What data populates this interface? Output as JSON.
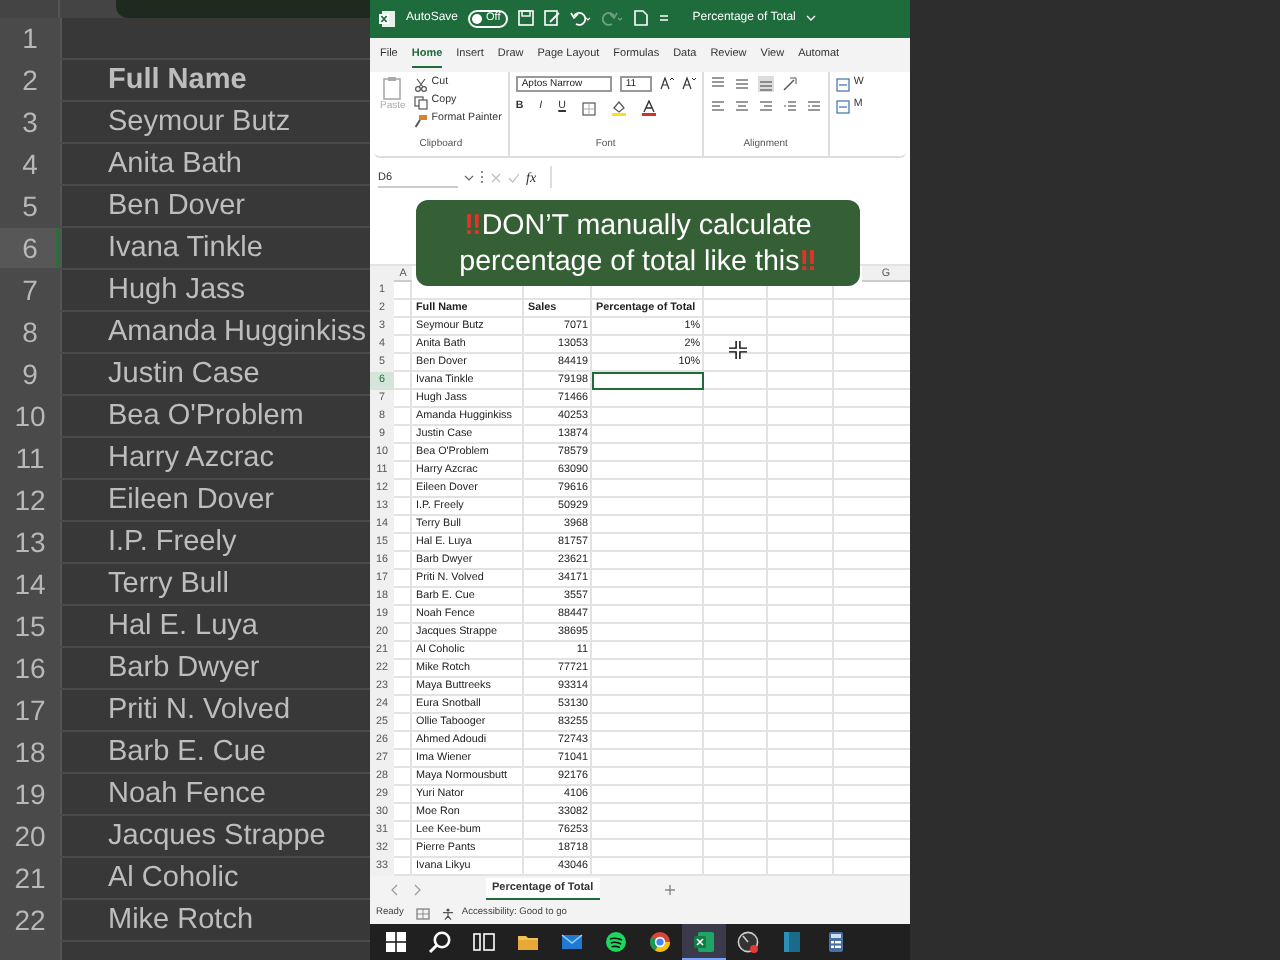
{
  "background_sheet": {
    "rows": [
      {
        "number": "1",
        "selected": false
      },
      {
        "number": "2",
        "name": "Full Name",
        "kind": "header",
        "selected": false
      },
      {
        "number": "3",
        "name": "Seymour Butz",
        "kind": "data",
        "selected": false
      },
      {
        "number": "4",
        "name": "Anita Bath",
        "kind": "data",
        "selected": false
      },
      {
        "number": "5",
        "name": "Ben Dover",
        "kind": "data",
        "selected": false
      },
      {
        "number": "6",
        "name": "Ivana Tinkle",
        "kind": "data",
        "selected": true
      },
      {
        "number": "7",
        "name": "Hugh Jass",
        "kind": "data",
        "selected": false
      },
      {
        "number": "8",
        "name": "Amanda Hugginkiss",
        "kind": "data",
        "selected": false
      },
      {
        "number": "9",
        "name": "Justin Case",
        "kind": "data",
        "selected": false
      },
      {
        "number": "10",
        "name": "Bea O'Problem",
        "kind": "data",
        "selected": false
      },
      {
        "number": "11",
        "name": "Harry Azcrac",
        "kind": "data",
        "selected": false
      },
      {
        "number": "12",
        "name": "Eileen Dover",
        "kind": "data",
        "selected": false
      },
      {
        "number": "13",
        "name": "I.P. Freely",
        "kind": "data",
        "selected": false
      },
      {
        "number": "14",
        "name": "Terry Bull",
        "kind": "data",
        "selected": false
      },
      {
        "number": "15",
        "name": "Hal E. Luya",
        "kind": "data",
        "selected": false
      },
      {
        "number": "16",
        "name": "Barb Dwyer",
        "kind": "data",
        "selected": false
      },
      {
        "number": "17",
        "name": "Priti N. Volved",
        "kind": "data",
        "selected": false
      },
      {
        "number": "18",
        "name": "Barb E. Cue",
        "kind": "data",
        "selected": false
      },
      {
        "number": "19",
        "name": "Noah Fence",
        "kind": "data",
        "selected": false
      },
      {
        "number": "20",
        "name": "Jacques Strappe",
        "kind": "data",
        "selected": false
      },
      {
        "number": "21",
        "name": "Al Coholic",
        "kind": "data",
        "selected": false
      },
      {
        "number": "22",
        "name": "Mike Rotch",
        "kind": "data",
        "selected": false
      }
    ]
  },
  "excel": {
    "title_bar": {
      "autosave_label": "AutoSave",
      "autosave_toggle": {
        "label": "Off",
        "on": false
      },
      "redo_disabled": true,
      "title": "Percentage of Total"
    },
    "tabs": [
      {
        "label": "File",
        "selected": false
      },
      {
        "label": "Home",
        "selected": true
      },
      {
        "label": "Insert",
        "selected": false
      },
      {
        "label": "Draw",
        "selected": false
      },
      {
        "label": "Page Layout",
        "selected": false
      },
      {
        "label": "Formulas",
        "selected": false
      },
      {
        "label": "Data",
        "selected": false
      },
      {
        "label": "Review",
        "selected": false
      },
      {
        "label": "View",
        "selected": false
      },
      {
        "label": "Automat",
        "selected": false
      }
    ],
    "ribbon": {
      "clipboard": {
        "paste": {
          "label": "Paste",
          "disabled": true
        },
        "cut": "Cut",
        "copy": "Copy",
        "format_painter": "Format Painter",
        "group_label": "Clipboard"
      },
      "font": {
        "name": "Aptos Narrow",
        "size": "11",
        "bold": "B",
        "italic": "I",
        "underline": "U",
        "group_label": "Font"
      },
      "alignment": {
        "group_label": "Alignment"
      },
      "cut_off_buttons": [
        "W",
        "M"
      ]
    },
    "formula_bar": {
      "name_box": "D6",
      "fx": "fx"
    },
    "column_headers": [
      "A",
      "G"
    ],
    "rows": [
      {
        "number": "1",
        "selected": false
      },
      {
        "number": "2",
        "kind": "header",
        "name": "Full Name",
        "sales": "Sales",
        "percentage": "Percentage of Total",
        "selected": false
      },
      {
        "number": "3",
        "kind": "data",
        "name": "Seymour Butz",
        "sales": "7071",
        "percentage": "1%",
        "selected": false
      },
      {
        "number": "4",
        "kind": "data",
        "name": "Anita Bath",
        "sales": "13053",
        "percentage": "2%",
        "selected": false
      },
      {
        "number": "5",
        "kind": "data",
        "name": "Ben Dover",
        "sales": "84419",
        "percentage": "10%",
        "selected": false
      },
      {
        "number": "6",
        "kind": "data",
        "name": "Ivana Tinkle",
        "sales": "79198",
        "selected": true
      },
      {
        "number": "7",
        "kind": "data",
        "name": "Hugh Jass",
        "sales": "71466",
        "selected": false
      },
      {
        "number": "8",
        "kind": "data",
        "name": "Amanda Hugginkiss",
        "sales": "40253",
        "selected": false
      },
      {
        "number": "9",
        "kind": "data",
        "name": "Justin Case",
        "sales": "13874",
        "selected": false
      },
      {
        "number": "10",
        "kind": "data",
        "name": "Bea O'Problem",
        "sales": "78579",
        "selected": false
      },
      {
        "number": "11",
        "kind": "data",
        "name": "Harry Azcrac",
        "sales": "63090",
        "selected": false
      },
      {
        "number": "12",
        "kind": "data",
        "name": "Eileen Dover",
        "sales": "79616",
        "selected": false
      },
      {
        "number": "13",
        "kind": "data",
        "name": "I.P. Freely",
        "sales": "50929",
        "selected": false
      },
      {
        "number": "14",
        "kind": "data",
        "name": "Terry Bull",
        "sales": "3968",
        "selected": false
      },
      {
        "number": "15",
        "kind": "data",
        "name": "Hal E. Luya",
        "sales": "81757",
        "selected": false
      },
      {
        "number": "16",
        "kind": "data",
        "name": "Barb Dwyer",
        "sales": "23621",
        "selected": false
      },
      {
        "number": "17",
        "kind": "data",
        "name": "Priti N. Volved",
        "sales": "34171",
        "selected": false
      },
      {
        "number": "18",
        "kind": "data",
        "name": "Barb E. Cue",
        "sales": "3557",
        "selected": false
      },
      {
        "number": "19",
        "kind": "data",
        "name": "Noah Fence",
        "sales": "88447",
        "selected": false
      },
      {
        "number": "20",
        "kind": "data",
        "name": "Jacques Strappe",
        "sales": "38695",
        "selected": false
      },
      {
        "number": "21",
        "kind": "data",
        "name": "Al Coholic",
        "sales": "11",
        "selected": false
      },
      {
        "number": "22",
        "kind": "data",
        "name": "Mike Rotch",
        "sales": "77721",
        "selected": false
      },
      {
        "number": "23",
        "kind": "data",
        "name": "Maya Buttreeks",
        "sales": "93314",
        "selected": false
      },
      {
        "number": "24",
        "kind": "data",
        "name": "Eura Snotball",
        "sales": "53130",
        "selected": false
      },
      {
        "number": "25",
        "kind": "data",
        "name": "Ollie Tabooger",
        "sales": "83255",
        "selected": false
      },
      {
        "number": "26",
        "kind": "data",
        "name": "Ahmed Adoudi",
        "sales": "72743",
        "selected": false
      },
      {
        "number": "27",
        "kind": "data",
        "name": "Ima Wiener",
        "sales": "71041",
        "selected": false
      },
      {
        "number": "28",
        "kind": "data",
        "name": "Maya Normousbutt",
        "sales": "92176",
        "selected": false
      },
      {
        "number": "29",
        "kind": "data",
        "name": "Yuri Nator",
        "sales": "4106",
        "selected": false
      },
      {
        "number": "30",
        "kind": "data",
        "name": "Moe Ron",
        "sales": "33082",
        "selected": false
      },
      {
        "number": "31",
        "kind": "data",
        "name": "Lee Kee-bum",
        "sales": "76253",
        "selected": false
      },
      {
        "number": "32",
        "kind": "data",
        "name": "Pierre Pants",
        "sales": "18718",
        "selected": false
      },
      {
        "number": "33",
        "kind": "data",
        "name": "Ivana Likyu",
        "sales": "43046",
        "selected": false
      }
    ],
    "sheet_tabs": [
      {
        "label": "Percentage of Total",
        "selected": true
      }
    ],
    "status_bar": {
      "status": "Ready",
      "accessibility": "Accessibility: Good to go"
    }
  },
  "banner": {
    "mark": "‼",
    "lines": [
      "DON’T manually calculate",
      "percentage of total like this"
    ]
  },
  "taskbar": {
    "apps": [
      {
        "kind": "start",
        "selected": false
      },
      {
        "kind": "search",
        "selected": false
      },
      {
        "kind": "task-view",
        "selected": false
      },
      {
        "kind": "folder",
        "selected": false
      },
      {
        "kind": "mail",
        "selected": false
      },
      {
        "kind": "music",
        "selected": false
      },
      {
        "kind": "browser",
        "selected": false
      },
      {
        "kind": "excel",
        "selected": true
      },
      {
        "kind": "recorder",
        "selected": false
      },
      {
        "kind": "panel",
        "selected": false
      },
      {
        "kind": "calculator",
        "selected": false
      }
    ]
  }
}
